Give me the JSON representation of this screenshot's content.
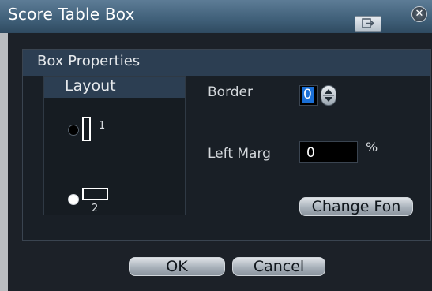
{
  "window": {
    "title": "Score Table Box",
    "pin_icon": "pin-window-icon",
    "close_icon": "close-icon",
    "close_glyph": "✕"
  },
  "box_properties": {
    "title": "Box Properties",
    "layout": {
      "title": "Layout",
      "options": [
        {
          "label": "1",
          "shape": "tall-rectangle-icon",
          "selected": false
        },
        {
          "label": "2",
          "shape": "wide-rectangle-icon",
          "selected": true
        }
      ]
    },
    "border": {
      "label": "Border",
      "value": "0"
    },
    "left_margin": {
      "label": "Left Marg",
      "value": "0",
      "unit": "%"
    },
    "change_font_label": "Change Fon"
  },
  "buttons": {
    "ok": "OK",
    "cancel": "Cancel"
  },
  "colors": {
    "titlebar": "#3f5f78",
    "panel_bg": "#1c2128",
    "header_bg": "#2c3e52",
    "selection": "#1a6fd6"
  }
}
